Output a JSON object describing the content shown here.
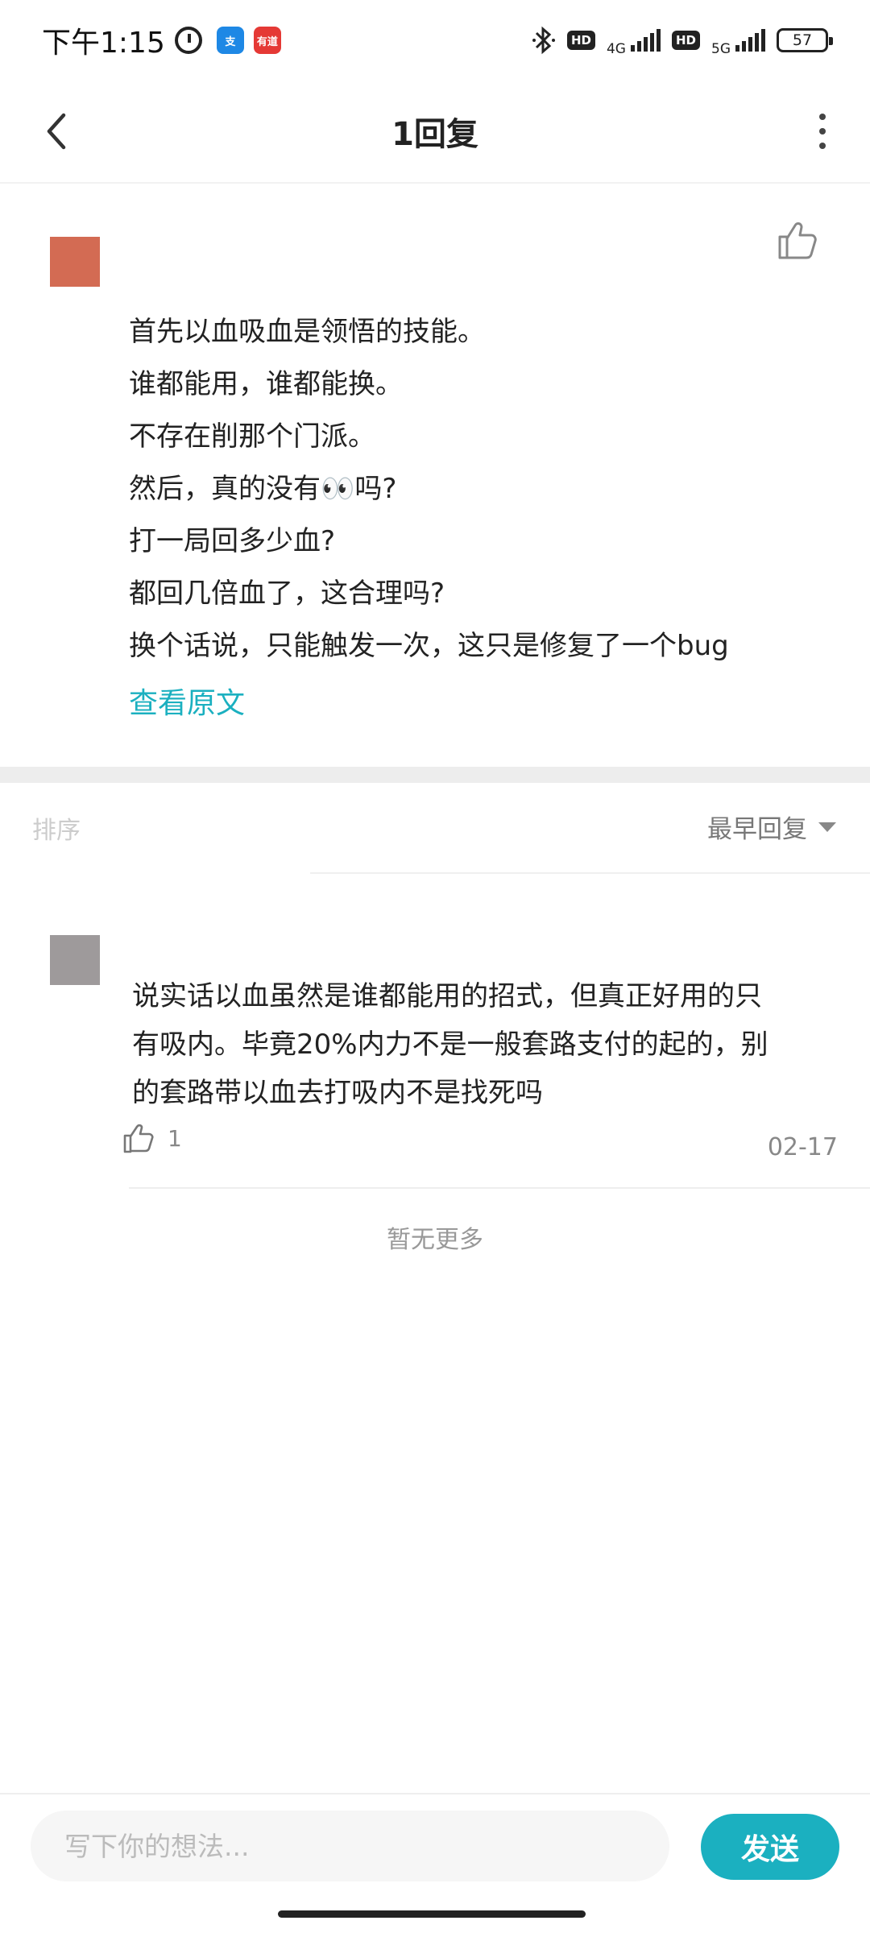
{
  "status_bar": {
    "time": "下午1:15",
    "app_badge_1": "支",
    "app_badge_2": "有道",
    "hd_1": "HD",
    "net_1": "4G",
    "hd_2": "HD",
    "net_2": "5G",
    "battery": "57",
    "icons": [
      "alarm-icon",
      "alipay-icon",
      "youdao-icon",
      "bluetooth-icon",
      "signal-icon",
      "battery-icon"
    ]
  },
  "nav": {
    "title": "1回复",
    "icons": [
      "back-arrow-icon",
      "more-vertical-icon"
    ]
  },
  "main_comment": {
    "lines": [
      "首先以血吸血是领悟的技能。",
      "谁都能用，谁都能换。",
      "不存在削那个门派。",
      "然后，真的没有👀吗?",
      "打一局回多少血?",
      "都回几倍血了，这合理吗?",
      "换个话说，只能触发一次，这只是修复了一个bug"
    ],
    "view_original": "查看原文",
    "avatar_color": "#d36b53"
  },
  "sort": {
    "label": "排序",
    "selected": "最早回复"
  },
  "reply": {
    "lines": [
      "说实话以血虽然是谁都能用的招式，但真正好用的只",
      "有吸内。毕竟20%内力不是一般套路支付的起的，别",
      "的套路带以血去打吸内不是找死吗"
    ],
    "like_count": "1",
    "date": "02-17",
    "avatar_color": "#9e9a9b"
  },
  "footer_note": "暂无更多",
  "input": {
    "placeholder": "写下你的想法...",
    "value": "",
    "send_label": "发送"
  },
  "colors": {
    "accent": "#1bb0c0"
  }
}
